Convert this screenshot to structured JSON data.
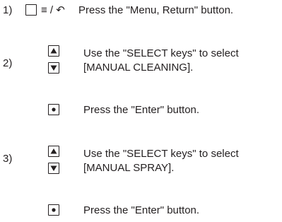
{
  "steps": [
    {
      "number": "1)",
      "symbols": "≡ / ↶",
      "text": "Press the \"Menu, Return\" button."
    },
    {
      "number": "2)",
      "select_text": [
        "Use the \"SELECT keys\" to select",
        "[MANUAL CLEANING]."
      ],
      "enter_text": "Press the \"Enter\" button."
    },
    {
      "number": "3)",
      "select_text": [
        "Use the \"SELECT keys\" to select",
        "[MANUAL SPRAY]."
      ],
      "enter_text": "Press the \"Enter\" button."
    }
  ],
  "icons": {
    "menu_button": "menu-return-button-icon",
    "up_key": "up-arrow-key-icon",
    "down_key": "down-arrow-key-icon",
    "enter_key": "enter-button-icon"
  }
}
